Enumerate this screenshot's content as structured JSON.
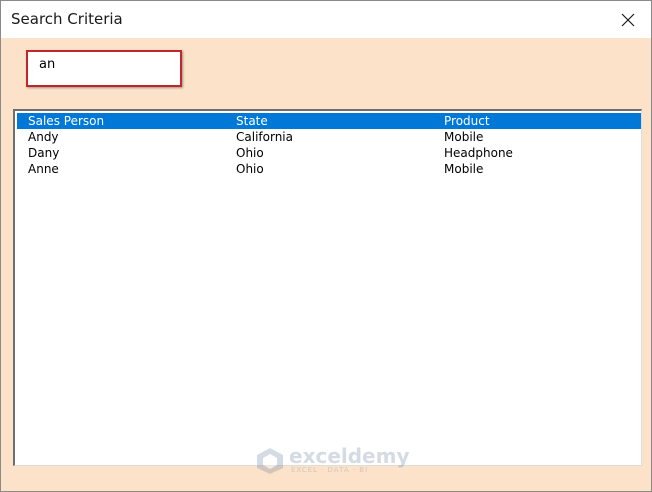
{
  "window": {
    "title": "Search Criteria",
    "close_icon": "close-icon"
  },
  "colors": {
    "form_background": "#fbe2c8",
    "selection": "#0078d7",
    "textbox_highlight": "#c0272d"
  },
  "search": {
    "value": "an"
  },
  "listbox": {
    "rows": [
      {
        "sales_person": "Sales Person",
        "state": "State",
        "product": "Product",
        "selected": true
      },
      {
        "sales_person": "Andy",
        "state": "California",
        "product": "Mobile",
        "selected": false
      },
      {
        "sales_person": "Dany",
        "state": "Ohio",
        "product": "Headphone",
        "selected": false
      },
      {
        "sales_person": "Anne",
        "state": "Ohio",
        "product": "Mobile",
        "selected": false
      }
    ]
  },
  "watermark": {
    "name": "exceldemy",
    "tagline": "EXCEL · DATA · BI",
    "icon": "exceldemy-logo-icon"
  }
}
